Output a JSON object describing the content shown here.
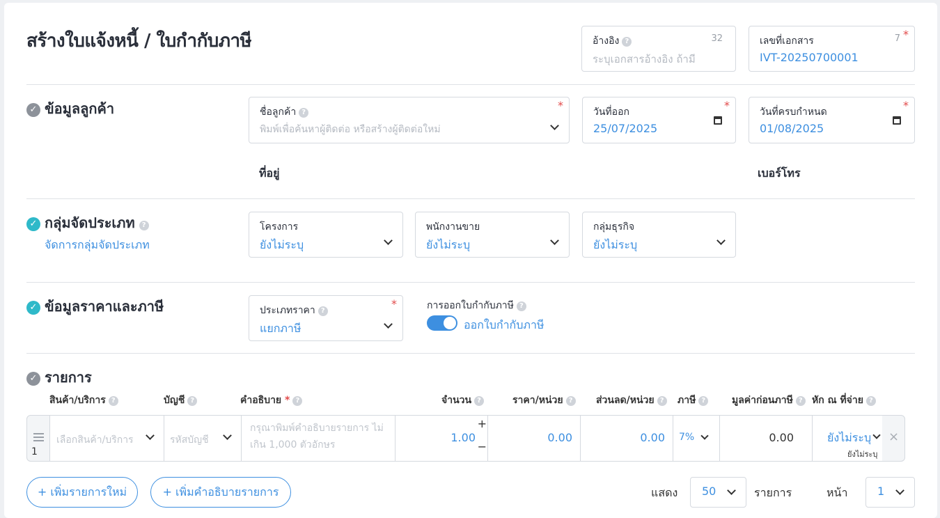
{
  "header": {
    "title": "สร้างใบแจ้งหนี้ / ใบกำกับภาษี",
    "reference": {
      "label": "อ้างอิง",
      "placeholder": "ระบุเอกสารอ้างอิง ถ้ามี",
      "counter": "32"
    },
    "doc_number": {
      "label": "เลขที่เอกสาร",
      "value": "IVT-20250700001",
      "counter": "7",
      "required": "*"
    }
  },
  "customer": {
    "section_title": "ข้อมูลลูกค้า",
    "name": {
      "label": "ชื่อลูกค้า",
      "placeholder": "พิมพ์เพื่อค้นหาผู้ติดต่อ หรือสร้างผู้ติดต่อใหม่",
      "required": "*"
    },
    "issue_date": {
      "label": "วันที่ออก",
      "value": "25/07/2025",
      "required": "*"
    },
    "due_date": {
      "label": "วันที่ครบกำหนด",
      "value": "01/08/2025",
      "required": "*"
    },
    "address_label": "ที่อยู่",
    "phone_label": "เบอร์โทร"
  },
  "classification": {
    "section_title": "กลุ่มจัดประเภท",
    "manage_link": "จัดการกลุ่มจัดประเภท",
    "project": {
      "label": "โครงการ",
      "value": "ยังไม่ระบุ"
    },
    "salesperson": {
      "label": "พนักงานขาย",
      "value": "ยังไม่ระบุ"
    },
    "business_group": {
      "label": "กลุ่มธุรกิจ",
      "value": "ยังไม่ระบุ"
    }
  },
  "pricing": {
    "section_title": "ข้อมูลราคาและภาษี",
    "price_type": {
      "label": "ประเภทราคา",
      "value": "แยกภาษี",
      "required": "*"
    },
    "tax_invoice": {
      "label": "การออกใบกำกับภาษี",
      "toggle_label": "ออกใบกำกับภาษี",
      "enabled": true
    }
  },
  "items": {
    "section_title": "รายการ",
    "columns": {
      "product": "สินค้า/บริการ",
      "account": "บัญชี",
      "description": "คำอธิบาย",
      "description_req": "*",
      "quantity": "จำนวน",
      "unit_price": "ราคา/หน่วย",
      "discount": "ส่วนลด/หน่วย",
      "tax": "ภาษี",
      "pre_tax": "มูลค่าก่อนภาษี",
      "withholding": "หัก ณ ที่จ่าย"
    },
    "rows": [
      {
        "index": "1",
        "product_placeholder": "เลือกสินค้า/บริการ",
        "account_placeholder": "รหัสบัญชี",
        "description_placeholder": "กรุณาพิมพ์คำอธิบายรายการ ไม่เกิน 1,000 ตัวอักษร",
        "quantity": "1.00",
        "unit_price": "0.00",
        "discount": "0.00",
        "tax": "7%",
        "pre_tax": "0.00",
        "withholding": "ยังไม่ระบุ",
        "withholding_sub": "ยังไม่ระบุ"
      }
    ],
    "add_item_button": "+ เพิ่มรายการใหม่",
    "add_description_button": "+ เพิ่มคำอธิบายรายการ",
    "pagination": {
      "show_label": "แสดง",
      "per_page": "50",
      "items_label": "รายการ",
      "page_label": "หน้า",
      "page": "1"
    }
  },
  "colors": {
    "accent": "#3d8fe0",
    "teal_check": "#2fb9c9",
    "required": "#e24b4b"
  }
}
